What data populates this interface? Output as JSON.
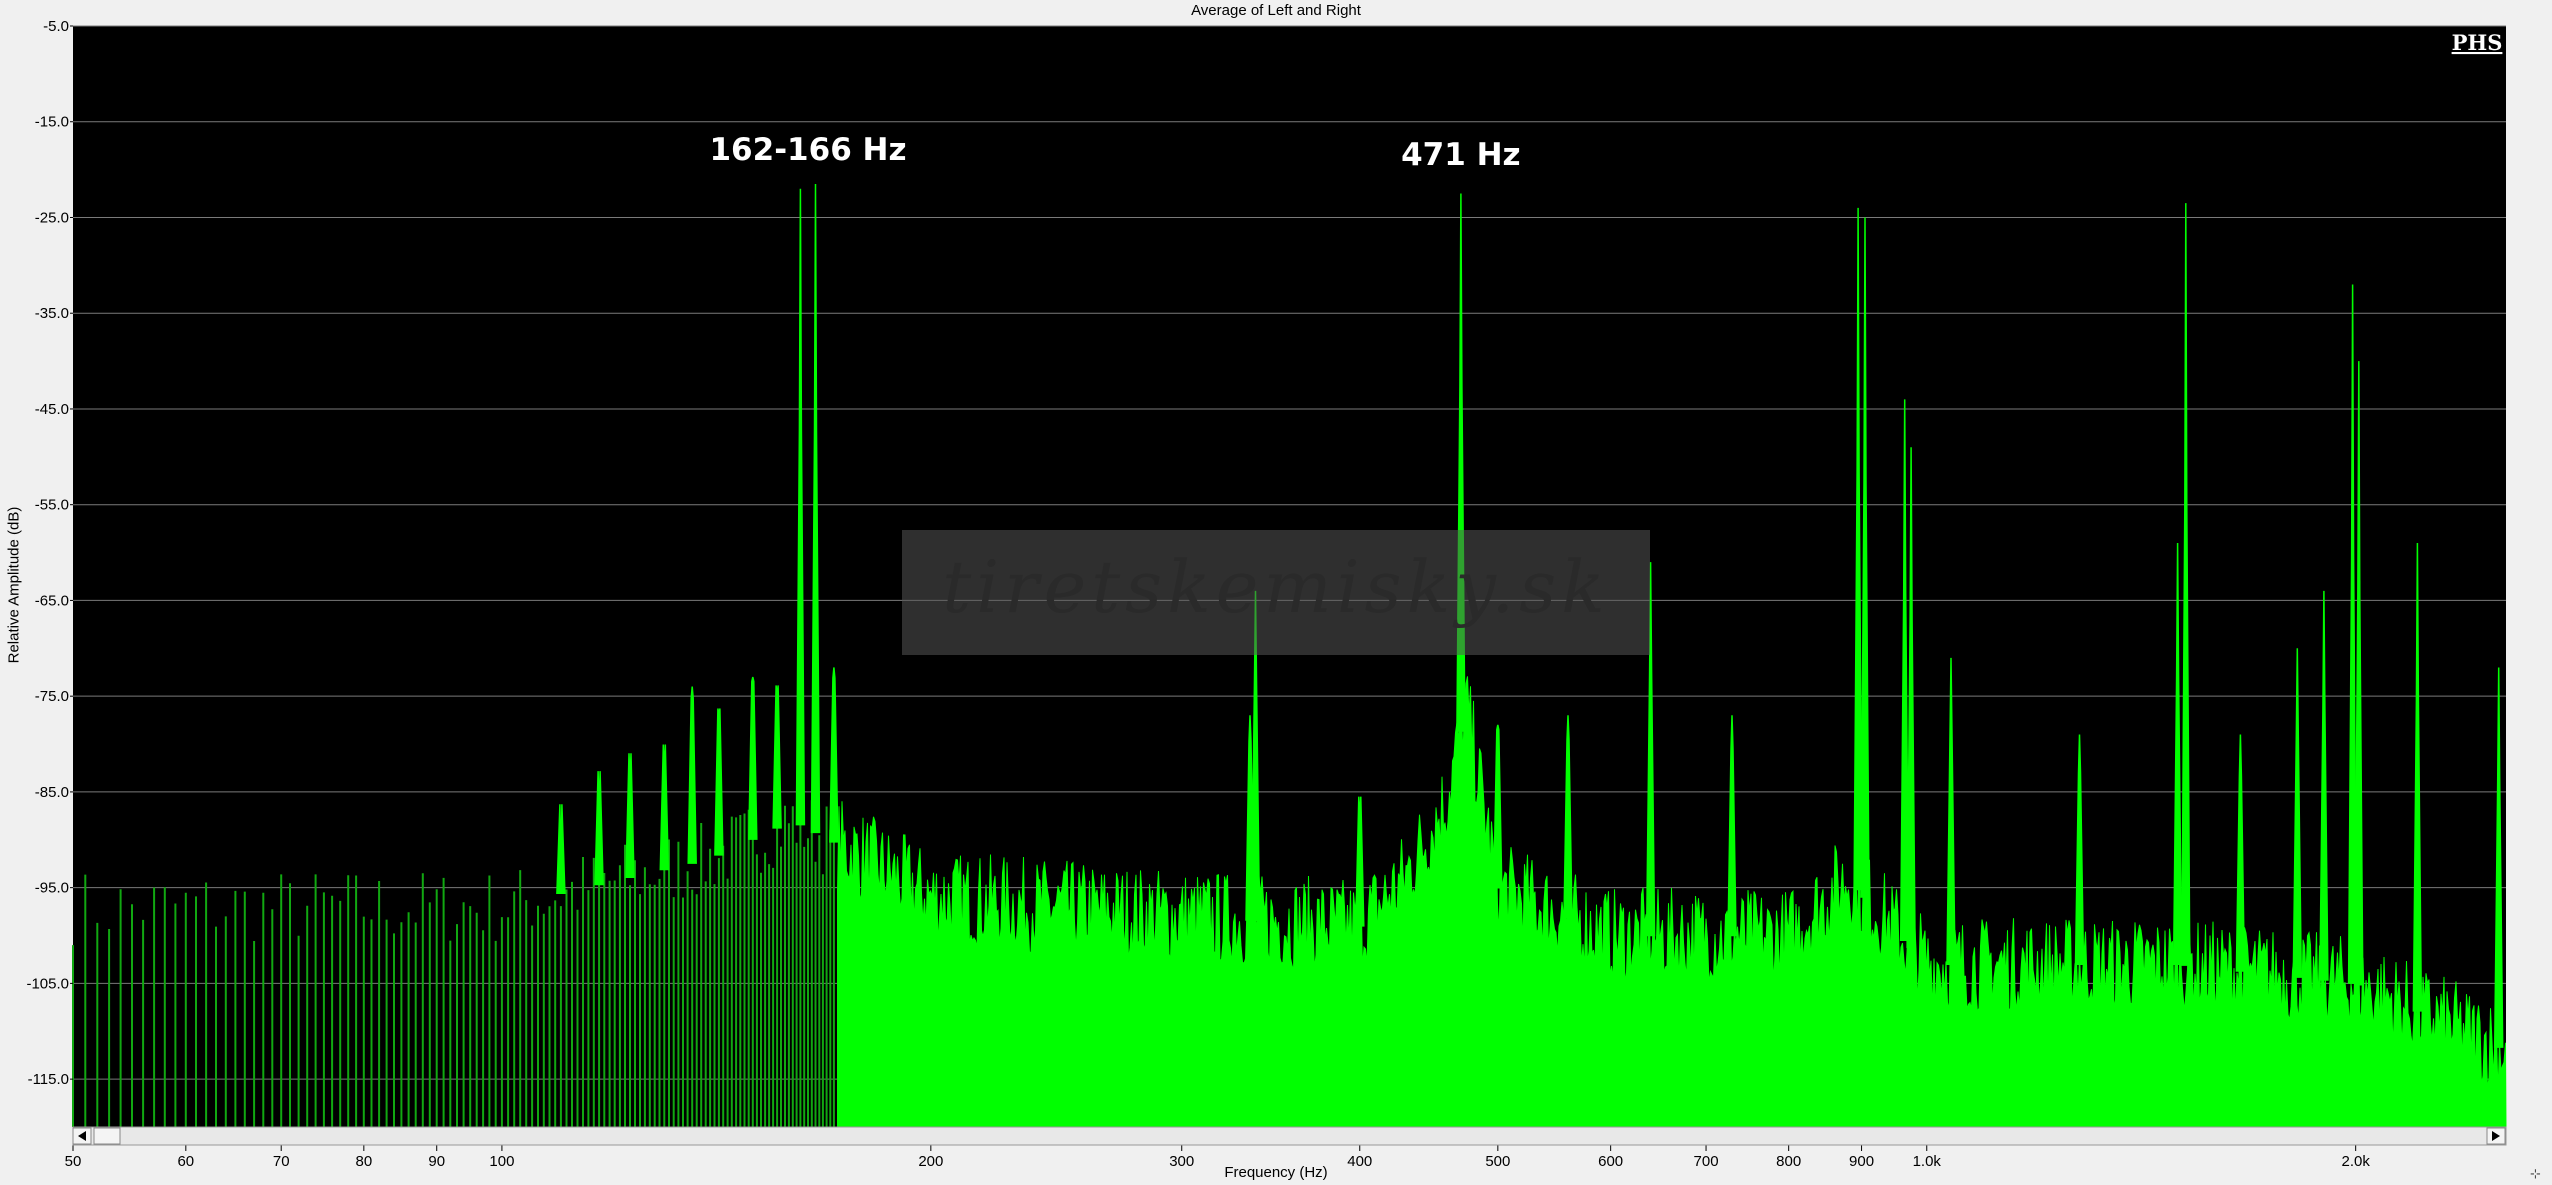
{
  "title": "Average of Left and Right",
  "logo_text": "PHS",
  "watermark_text": "tiretskemisky.sk",
  "colors": {
    "background": "#000000",
    "spectrum": "#00ff00",
    "spectrum_low": "#11a811",
    "grid": "#7a7a7a",
    "frame": "#f0f0f0"
  },
  "chart_data": {
    "type": "area",
    "title": "Average of Left and Right",
    "xlabel": "Frequency (Hz)",
    "ylabel": "Relative Amplitude (dB)",
    "x_scale": "log",
    "xlim": [
      50,
      2550
    ],
    "ylim": [
      -120.0,
      -5.0
    ],
    "y_ticks": [
      "-5.0",
      "-15.0",
      "-25.0",
      "-35.0",
      "-45.0",
      "-55.0",
      "-65.0",
      "-75.0",
      "-85.0",
      "-95.0",
      "-105.0",
      "-115.0"
    ],
    "x_ticks": [
      {
        "value": 50,
        "label": "50"
      },
      {
        "value": 60,
        "label": "60"
      },
      {
        "value": 70,
        "label": "70"
      },
      {
        "value": 80,
        "label": "80"
      },
      {
        "value": 90,
        "label": "90"
      },
      {
        "value": 100,
        "label": "100"
      },
      {
        "value": 200,
        "label": "200"
      },
      {
        "value": 300,
        "label": "300"
      },
      {
        "value": 400,
        "label": "400"
      },
      {
        "value": 500,
        "label": "500"
      },
      {
        "value": 600,
        "label": "600"
      },
      {
        "value": 700,
        "label": "700"
      },
      {
        "value": 800,
        "label": "800"
      },
      {
        "value": 900,
        "label": "900"
      },
      {
        "value": 1000,
        "label": "1.0k"
      },
      {
        "value": 2000,
        "label": "2.0k"
      }
    ],
    "grid": true,
    "noise_floor_db": [
      {
        "f": 50,
        "db": -97
      },
      {
        "f": 100,
        "db": -97
      },
      {
        "f": 140,
        "db": -92
      },
      {
        "f": 160,
        "db": -88
      },
      {
        "f": 175,
        "db": -91
      },
      {
        "f": 200,
        "db": -96
      },
      {
        "f": 300,
        "db": -98
      },
      {
        "f": 400,
        "db": -99
      },
      {
        "f": 430,
        "db": -94
      },
      {
        "f": 460,
        "db": -86
      },
      {
        "f": 475,
        "db": -76
      },
      {
        "f": 500,
        "db": -95
      },
      {
        "f": 600,
        "db": -100
      },
      {
        "f": 700,
        "db": -100
      },
      {
        "f": 800,
        "db": -100
      },
      {
        "f": 880,
        "db": -94
      },
      {
        "f": 1000,
        "db": -103
      },
      {
        "f": 1500,
        "db": -103
      },
      {
        "f": 2000,
        "db": -105
      },
      {
        "f": 2550,
        "db": -112
      }
    ],
    "peaks": [
      {
        "f": 110,
        "db": -93
      },
      {
        "f": 117,
        "db": -87
      },
      {
        "f": 123,
        "db": -84
      },
      {
        "f": 130,
        "db": -83
      },
      {
        "f": 136,
        "db": -74
      },
      {
        "f": 142,
        "db": -77
      },
      {
        "f": 150,
        "db": -73
      },
      {
        "f": 156,
        "db": -75
      },
      {
        "f": 162,
        "db": -22
      },
      {
        "f": 166,
        "db": -21.5
      },
      {
        "f": 171,
        "db": -72
      },
      {
        "f": 335,
        "db": -77
      },
      {
        "f": 338,
        "db": -64
      },
      {
        "f": 400,
        "db": -88
      },
      {
        "f": 471,
        "db": -22.5
      },
      {
        "f": 500,
        "db": -78
      },
      {
        "f": 560,
        "db": -77
      },
      {
        "f": 640,
        "db": -61
      },
      {
        "f": 730,
        "db": -77
      },
      {
        "f": 895,
        "db": -24
      },
      {
        "f": 905,
        "db": -25
      },
      {
        "f": 965,
        "db": -44
      },
      {
        "f": 975,
        "db": -49
      },
      {
        "f": 1040,
        "db": -71
      },
      {
        "f": 1280,
        "db": -79
      },
      {
        "f": 1500,
        "db": -59
      },
      {
        "f": 1520,
        "db": -23.5
      },
      {
        "f": 1660,
        "db": -79
      },
      {
        "f": 1820,
        "db": -70
      },
      {
        "f": 1900,
        "db": -64
      },
      {
        "f": 1990,
        "db": -32
      },
      {
        "f": 2010,
        "db": -40
      },
      {
        "f": 2210,
        "db": -59
      },
      {
        "f": 2520,
        "db": -72
      }
    ],
    "annotations": [
      {
        "text": "162-166 Hz",
        "f": 164,
        "db": -19
      },
      {
        "text": "471 Hz",
        "f": 471,
        "db": -19.5
      }
    ]
  }
}
